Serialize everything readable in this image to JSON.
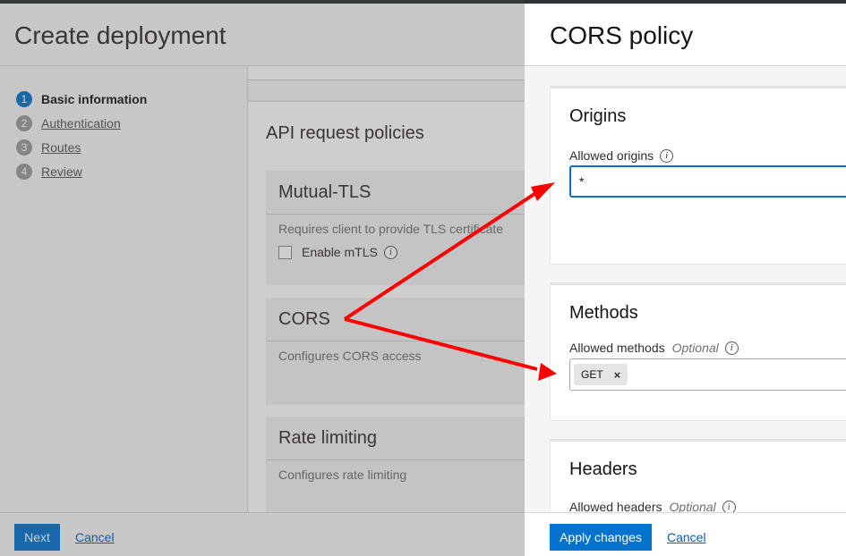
{
  "page": {
    "title": "Create deployment",
    "steps": [
      {
        "num": "1",
        "label": "Basic information"
      },
      {
        "num": "2",
        "label": "Authentication"
      },
      {
        "num": "3",
        "label": "Routes"
      },
      {
        "num": "4",
        "label": "Review"
      }
    ],
    "policies_title": "API request policies",
    "mtls": {
      "title": "Mutual-TLS",
      "desc": "Requires client to provide TLS certificate",
      "checkbox_label": "Enable mTLS",
      "info": "i"
    },
    "cors": {
      "title": "CORS",
      "desc": "Configures CORS access"
    },
    "rate": {
      "title": "Rate limiting",
      "desc": "Configures rate limiting"
    },
    "footer": {
      "next": "Next",
      "cancel": "Cancel"
    }
  },
  "panel": {
    "title": "CORS policy",
    "origins": {
      "title": "Origins",
      "label": "Allowed origins",
      "info": "i",
      "value": "*"
    },
    "methods": {
      "title": "Methods",
      "label": "Allowed methods",
      "optional": "Optional",
      "info": "i",
      "chip": "GET",
      "chip_remove": "×"
    },
    "headers": {
      "title": "Headers",
      "label": "Allowed headers",
      "optional": "Optional",
      "info": "i"
    },
    "footer": {
      "apply": "Apply changes",
      "cancel": "Cancel"
    }
  },
  "colors": {
    "accent": "#0572ce",
    "annotation_arrow": "#ff0000"
  }
}
